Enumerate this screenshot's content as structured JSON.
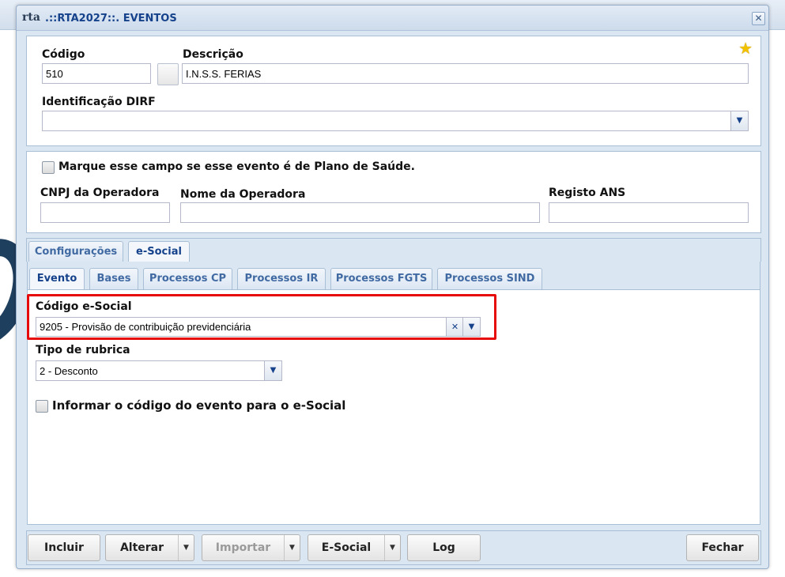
{
  "window": {
    "title": ".::RTA2027::. EVENTOS",
    "close_glyph": "✕",
    "logo_text": "rta"
  },
  "header": {
    "codigo_label": "Código",
    "codigo_value": "510",
    "descricao_label": "Descrição",
    "descricao_value": "I.N.S.S. FERIAS",
    "dirf_label": "Identificação DIRF",
    "dirf_value": "",
    "favorite_glyph": "★"
  },
  "plano_saude": {
    "checkbox_label": "Marque esse campo se esse evento é de Plano de Saúde.",
    "checked": false,
    "cnpj_label": "CNPJ da Operadora",
    "cnpj_value": "",
    "nome_label": "Nome da Operadora",
    "nome_value": "",
    "registo_label": "Registo ANS",
    "registo_value": ""
  },
  "main_tabs": [
    {
      "label": "Configurações",
      "active": false
    },
    {
      "label": "e-Social",
      "active": true
    }
  ],
  "sub_tabs": [
    {
      "label": "Evento",
      "active": true
    },
    {
      "label": "Bases",
      "active": false
    },
    {
      "label": "Processos CP",
      "active": false
    },
    {
      "label": "Processos IR",
      "active": false
    },
    {
      "label": "Processos FGTS",
      "active": false
    },
    {
      "label": "Processos SIND",
      "active": false
    }
  ],
  "evento": {
    "codigo_esocial_label": "Código e-Social",
    "codigo_esocial_value": "9205 - Provisão de contribuição previdenciária",
    "clear_glyph": "✕",
    "tipo_rubrica_label": "Tipo de rubrica",
    "tipo_rubrica_value": "2 - Desconto",
    "informar_label": "Informar o código do evento para o e-Social",
    "informar_checked": false
  },
  "toolbar": {
    "incluir": "Incluir",
    "alterar": "Alterar",
    "importar": "Importar",
    "esocial": "E-Social",
    "log": "Log",
    "fechar": "Fechar",
    "arrow_glyph": "▼"
  },
  "colors": {
    "accent": "#15428b",
    "highlight_border": "#e60a0a",
    "window_bg": "#dbe6f3"
  }
}
